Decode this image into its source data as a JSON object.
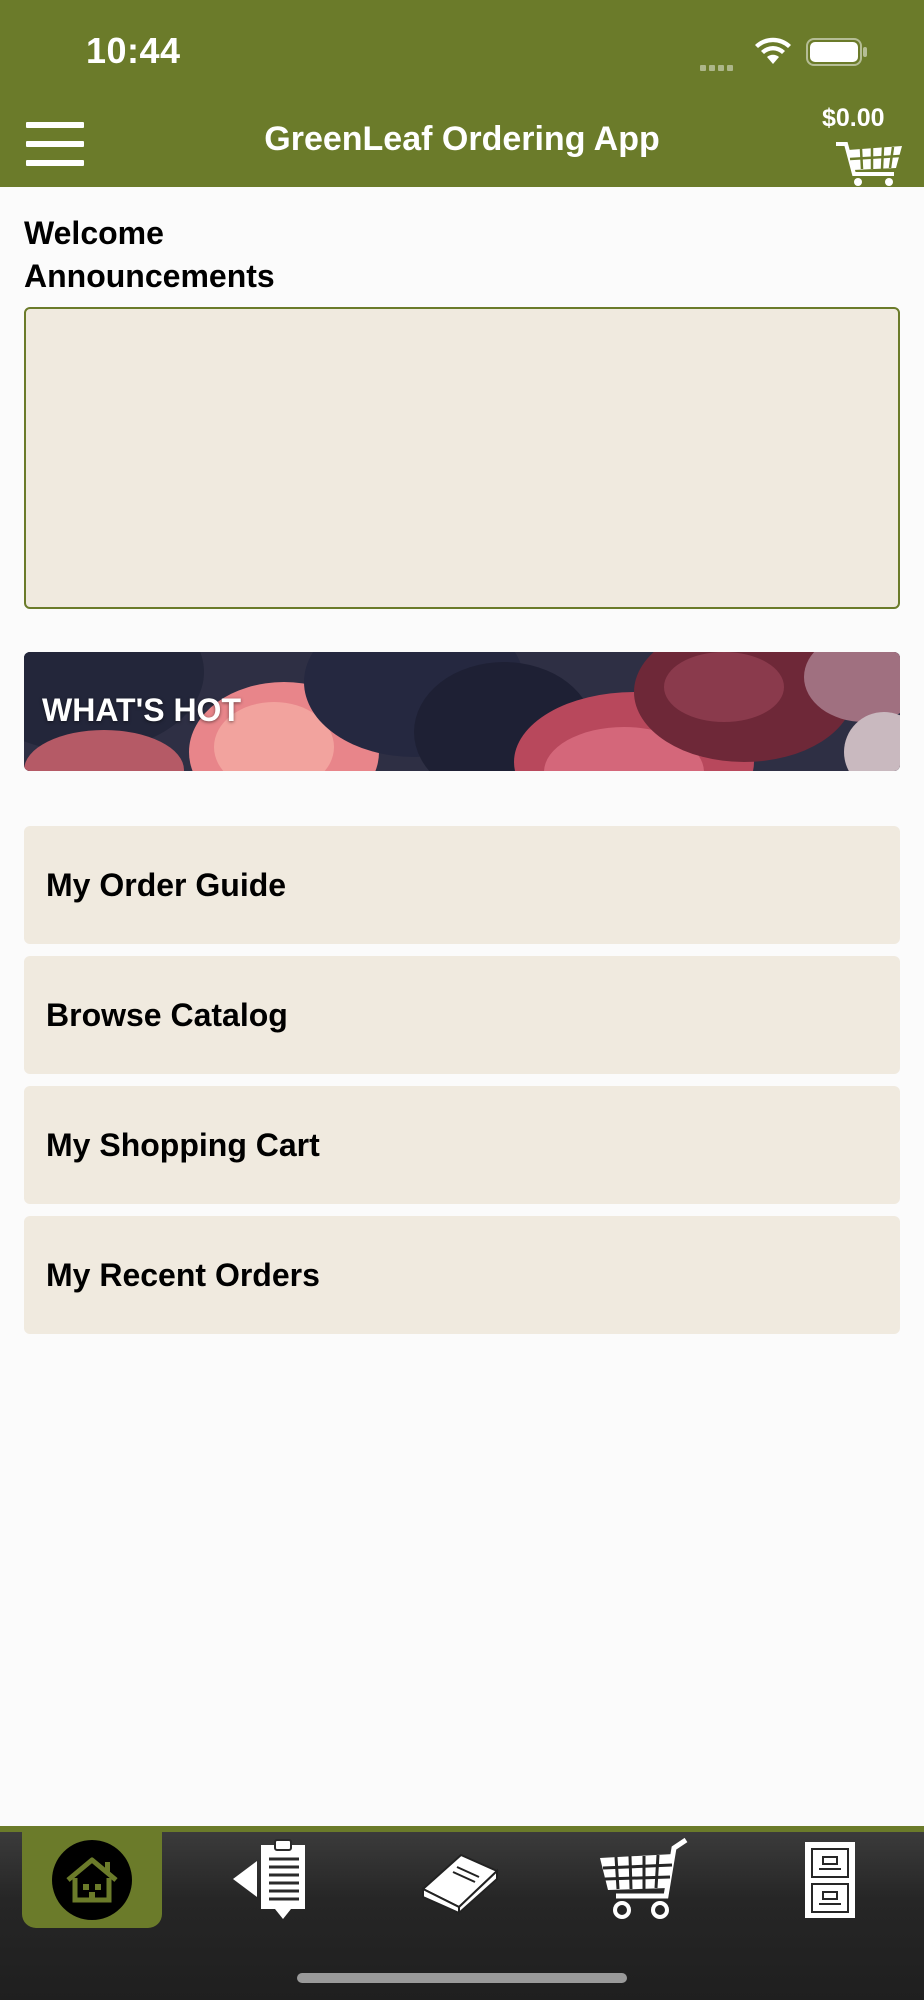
{
  "status_bar": {
    "time": "10:44"
  },
  "header": {
    "title": "GreenLeaf Ordering App",
    "cart_total": "$0.00",
    "menu_icon": "hamburger-menu-icon",
    "cart_icon": "shopping-cart-icon"
  },
  "announcements": {
    "heading": "Welcome\nAnnouncements",
    "heading_line1": "Welcome",
    "heading_line2": "Announcements",
    "content": ""
  },
  "banner": {
    "label": "WHAT'S HOT"
  },
  "menu": {
    "items": [
      {
        "label": "My Order Guide"
      },
      {
        "label": "Browse Catalog"
      },
      {
        "label": "My Shopping Cart"
      },
      {
        "label": "My Recent Orders"
      }
    ]
  },
  "tabbar": {
    "tabs": [
      {
        "icon": "home-icon",
        "active": true
      },
      {
        "icon": "order-guide-icon",
        "active": false
      },
      {
        "icon": "catalog-book-icon",
        "active": false
      },
      {
        "icon": "shopping-cart-icon",
        "active": false
      },
      {
        "icon": "file-cabinet-icon",
        "active": false
      }
    ]
  },
  "colors": {
    "brand_green": "#6b7b2a",
    "card_beige": "#f0eadf",
    "background": "#fbfbfb",
    "tabbar_dark": "#262626"
  }
}
